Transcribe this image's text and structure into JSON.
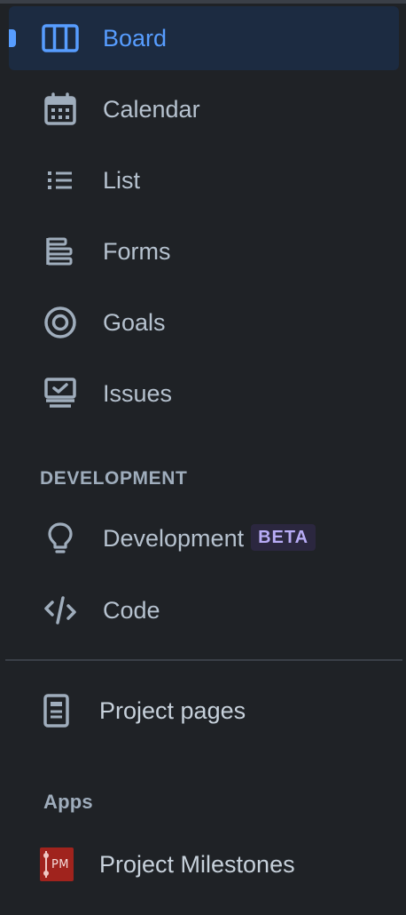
{
  "nav": {
    "items": [
      {
        "label": "Board",
        "icon": "board-icon",
        "selected": true
      },
      {
        "label": "Calendar",
        "icon": "calendar-icon"
      },
      {
        "label": "List",
        "icon": "list-icon"
      },
      {
        "label": "Forms",
        "icon": "forms-icon"
      },
      {
        "label": "Goals",
        "icon": "goals-icon"
      },
      {
        "label": "Issues",
        "icon": "issues-icon"
      }
    ]
  },
  "development": {
    "heading": "DEVELOPMENT",
    "items": [
      {
        "label": "Development",
        "badge": "BETA",
        "icon": "lightbulb-icon"
      },
      {
        "label": "Code",
        "icon": "code-icon"
      }
    ]
  },
  "pages": {
    "label": "Project pages",
    "icon": "document-icon"
  },
  "apps": {
    "heading": "Apps",
    "items": [
      {
        "label": "Project Milestones",
        "logo_text": "PM",
        "icon": "project-milestones-logo"
      }
    ]
  },
  "colors": {
    "background": "#1f2226",
    "accent": "#579dff",
    "selected_bg": "#1c2b41",
    "text": "#b6c2cf",
    "badge_text": "#b8acf6",
    "badge_bg": "#2b273f",
    "app_logo": "#a0231d"
  }
}
